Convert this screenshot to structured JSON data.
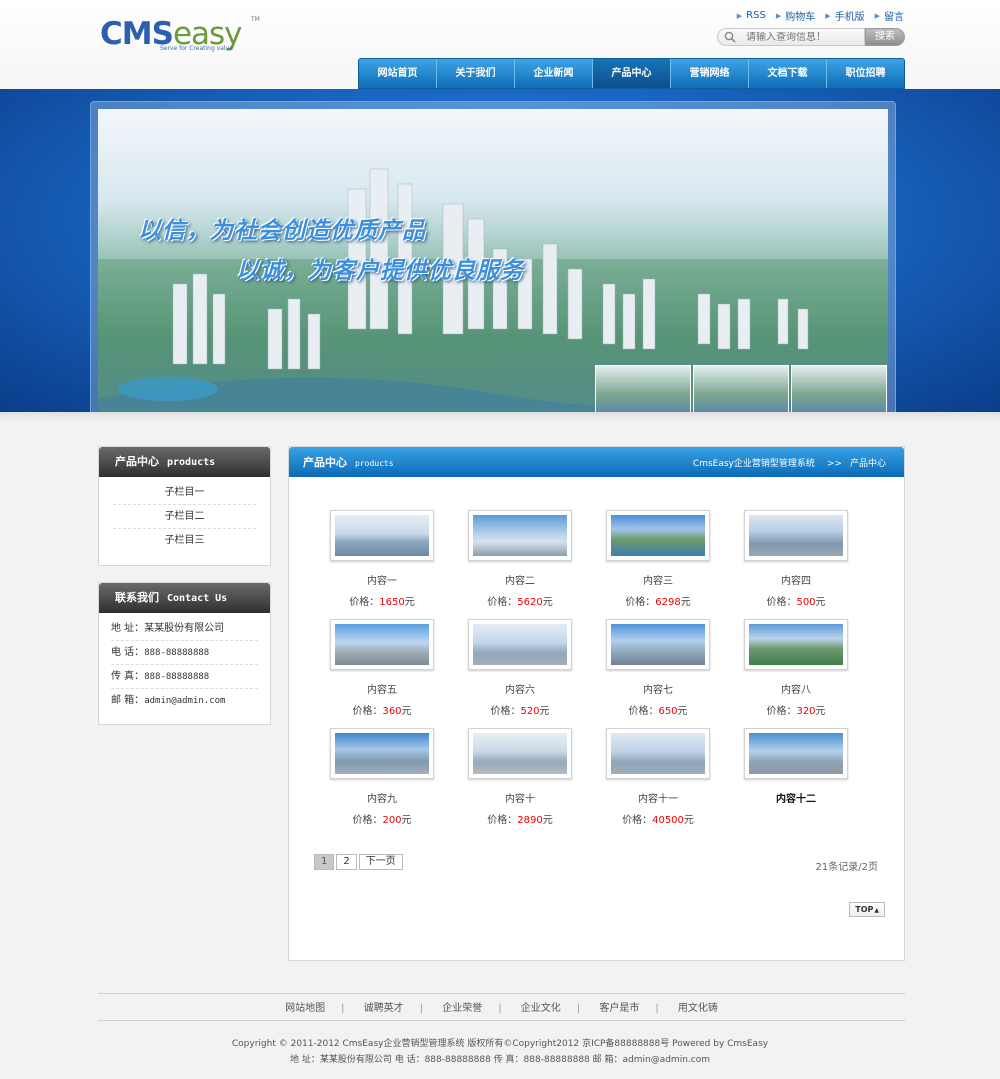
{
  "logo": {
    "main_cms": "CMS",
    "main_easy": "easy",
    "tm": "TM",
    "tagline": "Serve for Creating value"
  },
  "toplinks": [
    "RSS",
    "购物车",
    "手机版",
    "留言"
  ],
  "search": {
    "placeholder": "请输入查询信息！",
    "button": "搜索"
  },
  "nav": [
    "网站首页",
    "关于我们",
    "企业新闻",
    "产品中心",
    "营销网络",
    "文档下载",
    "职位招聘"
  ],
  "nav_active": 3,
  "banner": {
    "line1": "以信，为社会创造优质产品",
    "line2": "以诚，为客户提供优良服务"
  },
  "sidebar": {
    "products": {
      "title": "产品中心",
      "title_en": "products",
      "items": [
        "子栏目一",
        "子栏目二",
        "子栏目三"
      ]
    },
    "contact": {
      "title": "联系我们",
      "title_en": "Contact Us",
      "items": [
        {
          "label": "地 址：",
          "value": "某某股份有限公司"
        },
        {
          "label": "电 话：",
          "value": "888-88888888"
        },
        {
          "label": "传 真：",
          "value": "888-88888888"
        },
        {
          "label": "邮 箱：",
          "value": "admin@admin.com"
        }
      ]
    }
  },
  "main": {
    "title": "产品中心",
    "title_en": "products",
    "crumb_site": "CmsEasy企业营销型管理系统",
    "crumb_sep": ">>",
    "crumb_current": "产品中心",
    "price_label": "价格：",
    "price_unit": "元",
    "products": [
      {
        "name": "内容一",
        "price": "1650"
      },
      {
        "name": "内容二",
        "price": "5620"
      },
      {
        "name": "内容三",
        "price": "6298"
      },
      {
        "name": "内容四",
        "price": "500"
      },
      {
        "name": "内容五",
        "price": "360"
      },
      {
        "name": "内容六",
        "price": "520"
      },
      {
        "name": "内容七",
        "price": "650"
      },
      {
        "name": "内容八",
        "price": "320"
      },
      {
        "name": "内容九",
        "price": "200"
      },
      {
        "name": "内容十",
        "price": "2890"
      },
      {
        "name": "内容十一",
        "price": "40500"
      },
      {
        "name": "内容十二",
        "price": ""
      }
    ],
    "pager": {
      "pages": [
        "1",
        "2"
      ],
      "next": "下一页",
      "records": "21条记录/2页"
    },
    "top_button": "TOP"
  },
  "footer": {
    "links": [
      "网站地图",
      "诚聘英才",
      "企业荣誉",
      "企业文化",
      "客户是市",
      "用文化铸"
    ],
    "copyright": "Copyright © 2011-2012  CmsEasy企业营销型管理系统  版权所有©Copyright2012 京ICP备88888888号  Powered by  CmsEasy",
    "contact_line": "地 址：某某股份有限公司  电 话：888-88888888  传 真：888-88888888  邮 箱：admin@admin.com"
  },
  "colors": {
    "nav_blue": "#0d6db8",
    "price_red": "#ee0000",
    "link_blue": "#1e5ea8"
  }
}
